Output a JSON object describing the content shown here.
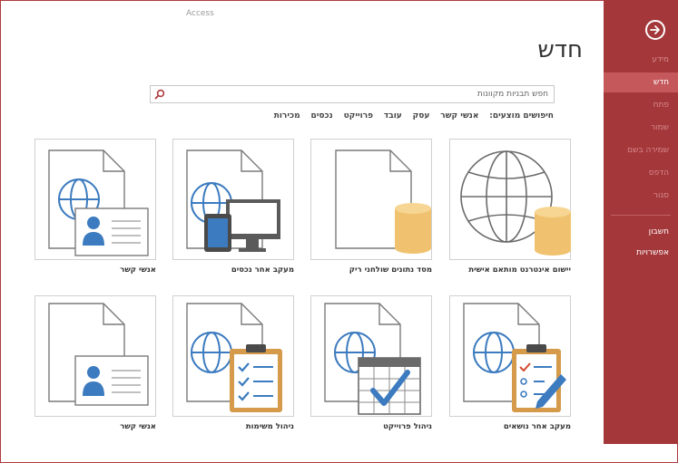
{
  "app": {
    "title": "Access"
  },
  "sidebar": {
    "items": [
      {
        "label": "מידע",
        "state": "dim"
      },
      {
        "label": "חדש",
        "state": "active"
      },
      {
        "label": "פתח",
        "state": "dim"
      },
      {
        "label": "שמור",
        "state": "dim"
      },
      {
        "label": "שמירה בשם",
        "state": "dim"
      },
      {
        "label": "הדפס",
        "state": "dim"
      },
      {
        "label": "סגור",
        "state": "dim"
      },
      {
        "label": "חשבון",
        "state": "bright"
      },
      {
        "label": "אפשרויות",
        "state": "bright"
      }
    ],
    "back_icon": "arrow-right-circle-icon",
    "colors": {
      "background": "#a4373a",
      "active": "#c4585b"
    }
  },
  "main": {
    "title": "חדש",
    "search": {
      "placeholder": "חפש תבניות מקוונות",
      "icon": "search-icon"
    },
    "suggested": {
      "label": "חיפושים מוצעים:",
      "links": [
        "אנשי קשר",
        "עסק",
        "עובד",
        "פרוייקט",
        "נכסים",
        "מכירות"
      ]
    },
    "templates": [
      {
        "label": "יישום אינטרנט מותאם אישית",
        "icon": "globe-database-icon"
      },
      {
        "label": "מסד נתונים שולחני ריק",
        "icon": "blank-database-icon"
      },
      {
        "label": "מעקב אחר נכסים",
        "icon": "asset-tracking-icon"
      },
      {
        "label": "אנשי קשר",
        "icon": "contacts-icon"
      },
      {
        "label": "מעקב אחר נושאים",
        "icon": "issue-tracking-icon"
      },
      {
        "label": "ניהול פרוייקט",
        "icon": "project-management-icon"
      },
      {
        "label": "ניהול משימות",
        "icon": "task-management-icon"
      },
      {
        "label": "אנשי קשר",
        "icon": "contacts-icon"
      }
    ]
  }
}
